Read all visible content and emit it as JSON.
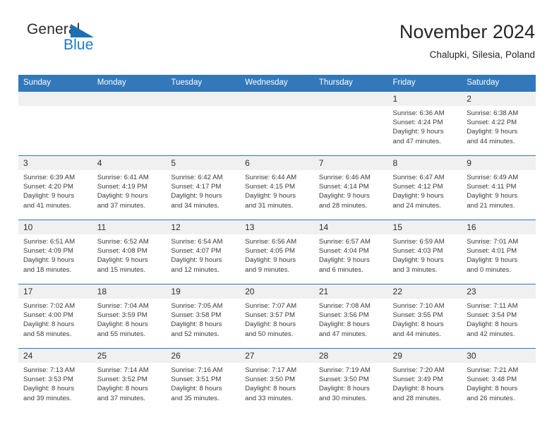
{
  "brand": {
    "name_top": "General",
    "name_bottom": "Blue",
    "flag_icon": "blue-triangle-flag-icon",
    "color_text": "#2b2b2b",
    "color_blue": "#1b7cc2"
  },
  "header": {
    "title": "November 2024",
    "subtitle": "Chalupki, Silesia, Poland"
  },
  "theme": {
    "header_blue": "#3278ba",
    "daynum_band": "#f0f0f0",
    "text": "#3a3a3a"
  },
  "calendar": {
    "weekday_headers": [
      "Sunday",
      "Monday",
      "Tuesday",
      "Wednesday",
      "Thursday",
      "Friday",
      "Saturday"
    ],
    "weeks": [
      [
        {
          "day": "",
          "empty": true
        },
        {
          "day": "",
          "empty": true
        },
        {
          "day": "",
          "empty": true
        },
        {
          "day": "",
          "empty": true
        },
        {
          "day": "",
          "empty": true
        },
        {
          "day": "1",
          "sunrise": "Sunrise: 6:36 AM",
          "sunset": "Sunset: 4:24 PM",
          "daylight1": "Daylight: 9 hours",
          "daylight2": "and 47 minutes."
        },
        {
          "day": "2",
          "sunrise": "Sunrise: 6:38 AM",
          "sunset": "Sunset: 4:22 PM",
          "daylight1": "Daylight: 9 hours",
          "daylight2": "and 44 minutes."
        }
      ],
      [
        {
          "day": "3",
          "sunrise": "Sunrise: 6:39 AM",
          "sunset": "Sunset: 4:20 PM",
          "daylight1": "Daylight: 9 hours",
          "daylight2": "and 41 minutes."
        },
        {
          "day": "4",
          "sunrise": "Sunrise: 6:41 AM",
          "sunset": "Sunset: 4:19 PM",
          "daylight1": "Daylight: 9 hours",
          "daylight2": "and 37 minutes."
        },
        {
          "day": "5",
          "sunrise": "Sunrise: 6:42 AM",
          "sunset": "Sunset: 4:17 PM",
          "daylight1": "Daylight: 9 hours",
          "daylight2": "and 34 minutes."
        },
        {
          "day": "6",
          "sunrise": "Sunrise: 6:44 AM",
          "sunset": "Sunset: 4:15 PM",
          "daylight1": "Daylight: 9 hours",
          "daylight2": "and 31 minutes."
        },
        {
          "day": "7",
          "sunrise": "Sunrise: 6:46 AM",
          "sunset": "Sunset: 4:14 PM",
          "daylight1": "Daylight: 9 hours",
          "daylight2": "and 28 minutes."
        },
        {
          "day": "8",
          "sunrise": "Sunrise: 6:47 AM",
          "sunset": "Sunset: 4:12 PM",
          "daylight1": "Daylight: 9 hours",
          "daylight2": "and 24 minutes."
        },
        {
          "day": "9",
          "sunrise": "Sunrise: 6:49 AM",
          "sunset": "Sunset: 4:11 PM",
          "daylight1": "Daylight: 9 hours",
          "daylight2": "and 21 minutes."
        }
      ],
      [
        {
          "day": "10",
          "sunrise": "Sunrise: 6:51 AM",
          "sunset": "Sunset: 4:09 PM",
          "daylight1": "Daylight: 9 hours",
          "daylight2": "and 18 minutes."
        },
        {
          "day": "11",
          "sunrise": "Sunrise: 6:52 AM",
          "sunset": "Sunset: 4:08 PM",
          "daylight1": "Daylight: 9 hours",
          "daylight2": "and 15 minutes."
        },
        {
          "day": "12",
          "sunrise": "Sunrise: 6:54 AM",
          "sunset": "Sunset: 4:07 PM",
          "daylight1": "Daylight: 9 hours",
          "daylight2": "and 12 minutes."
        },
        {
          "day": "13",
          "sunrise": "Sunrise: 6:56 AM",
          "sunset": "Sunset: 4:05 PM",
          "daylight1": "Daylight: 9 hours",
          "daylight2": "and 9 minutes."
        },
        {
          "day": "14",
          "sunrise": "Sunrise: 6:57 AM",
          "sunset": "Sunset: 4:04 PM",
          "daylight1": "Daylight: 9 hours",
          "daylight2": "and 6 minutes."
        },
        {
          "day": "15",
          "sunrise": "Sunrise: 6:59 AM",
          "sunset": "Sunset: 4:03 PM",
          "daylight1": "Daylight: 9 hours",
          "daylight2": "and 3 minutes."
        },
        {
          "day": "16",
          "sunrise": "Sunrise: 7:01 AM",
          "sunset": "Sunset: 4:01 PM",
          "daylight1": "Daylight: 9 hours",
          "daylight2": "and 0 minutes."
        }
      ],
      [
        {
          "day": "17",
          "sunrise": "Sunrise: 7:02 AM",
          "sunset": "Sunset: 4:00 PM",
          "daylight1": "Daylight: 8 hours",
          "daylight2": "and 58 minutes."
        },
        {
          "day": "18",
          "sunrise": "Sunrise: 7:04 AM",
          "sunset": "Sunset: 3:59 PM",
          "daylight1": "Daylight: 8 hours",
          "daylight2": "and 55 minutes."
        },
        {
          "day": "19",
          "sunrise": "Sunrise: 7:05 AM",
          "sunset": "Sunset: 3:58 PM",
          "daylight1": "Daylight: 8 hours",
          "daylight2": "and 52 minutes."
        },
        {
          "day": "20",
          "sunrise": "Sunrise: 7:07 AM",
          "sunset": "Sunset: 3:57 PM",
          "daylight1": "Daylight: 8 hours",
          "daylight2": "and 50 minutes."
        },
        {
          "day": "21",
          "sunrise": "Sunrise: 7:08 AM",
          "sunset": "Sunset: 3:56 PM",
          "daylight1": "Daylight: 8 hours",
          "daylight2": "and 47 minutes."
        },
        {
          "day": "22",
          "sunrise": "Sunrise: 7:10 AM",
          "sunset": "Sunset: 3:55 PM",
          "daylight1": "Daylight: 8 hours",
          "daylight2": "and 44 minutes."
        },
        {
          "day": "23",
          "sunrise": "Sunrise: 7:11 AM",
          "sunset": "Sunset: 3:54 PM",
          "daylight1": "Daylight: 8 hours",
          "daylight2": "and 42 minutes."
        }
      ],
      [
        {
          "day": "24",
          "sunrise": "Sunrise: 7:13 AM",
          "sunset": "Sunset: 3:53 PM",
          "daylight1": "Daylight: 8 hours",
          "daylight2": "and 39 minutes."
        },
        {
          "day": "25",
          "sunrise": "Sunrise: 7:14 AM",
          "sunset": "Sunset: 3:52 PM",
          "daylight1": "Daylight: 8 hours",
          "daylight2": "and 37 minutes."
        },
        {
          "day": "26",
          "sunrise": "Sunrise: 7:16 AM",
          "sunset": "Sunset: 3:51 PM",
          "daylight1": "Daylight: 8 hours",
          "daylight2": "and 35 minutes."
        },
        {
          "day": "27",
          "sunrise": "Sunrise: 7:17 AM",
          "sunset": "Sunset: 3:50 PM",
          "daylight1": "Daylight: 8 hours",
          "daylight2": "and 33 minutes."
        },
        {
          "day": "28",
          "sunrise": "Sunrise: 7:19 AM",
          "sunset": "Sunset: 3:50 PM",
          "daylight1": "Daylight: 8 hours",
          "daylight2": "and 30 minutes."
        },
        {
          "day": "29",
          "sunrise": "Sunrise: 7:20 AM",
          "sunset": "Sunset: 3:49 PM",
          "daylight1": "Daylight: 8 hours",
          "daylight2": "and 28 minutes."
        },
        {
          "day": "30",
          "sunrise": "Sunrise: 7:21 AM",
          "sunset": "Sunset: 3:48 PM",
          "daylight1": "Daylight: 8 hours",
          "daylight2": "and 26 minutes."
        }
      ]
    ]
  }
}
